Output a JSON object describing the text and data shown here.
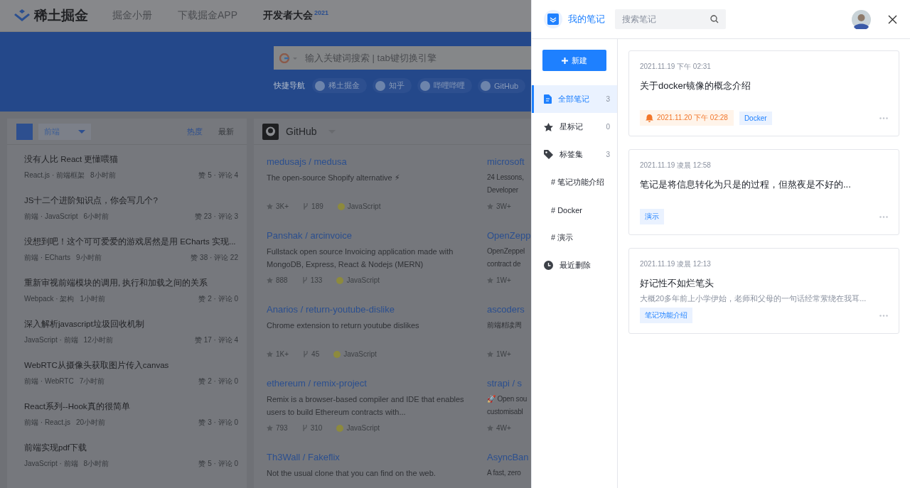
{
  "site_header": {
    "logo": "稀土掘金",
    "nav": [
      "掘金小册",
      "下载掘金APP",
      "开发者大会"
    ],
    "nav_badge": "2021"
  },
  "search": {
    "placeholder": "输入关键词搜索 | tab键切换引擎"
  },
  "quick_nav": {
    "label": "快捷导航",
    "links": [
      "稀土掘金",
      "知乎",
      "哔哩哔哩",
      "GitHub"
    ]
  },
  "article_feed": {
    "category": "前端",
    "sorts": [
      {
        "label": "热度",
        "selected": true
      },
      {
        "label": "最新",
        "selected": false
      }
    ],
    "articles": [
      {
        "title": "没有人比 React 更懂喂猫",
        "meta": "React.js · 前端框架",
        "time": "8小时前",
        "stats": "赞 5 · 评论 4"
      },
      {
        "title": "JS十二个进阶知识点，你会写几个?",
        "meta": "前端 · JavaScript",
        "time": "6小时前",
        "stats": "赞 23 · 评论 3"
      },
      {
        "title": "没想到吧！这个可可爱爱的游戏居然是用 ECharts 实现...",
        "meta": "前端 · ECharts",
        "time": "9小时前",
        "stats": "赞 38 · 评论 22"
      },
      {
        "title": "重新审视前端模块的调用, 执行和加载之间的关系",
        "meta": "Webpack · 架构",
        "time": "1小时前",
        "stats": "赞 2 · 评论 0"
      },
      {
        "title": "深入解析javascript垃圾回收机制",
        "meta": "JavaScript · 前端",
        "time": "12小时前",
        "stats": "赞 17 · 评论 4"
      },
      {
        "title": "WebRTC从摄像头获取图片传入canvas",
        "meta": "前端 · WebRTC",
        "time": "7小时前",
        "stats": "赞 2 · 评论 0"
      },
      {
        "title": "React系列--Hook真的很简单",
        "meta": "前端 · React.js",
        "time": "20小时前",
        "stats": "赞 3 · 评论 0"
      },
      {
        "title": "前端实现pdf下载",
        "meta": "JavaScript · 前端",
        "time": "8小时前",
        "stats": "赞 5 · 评论 0"
      }
    ]
  },
  "github": {
    "title": "GitHub",
    "repos": [
      {
        "name": "medusajs / medusa",
        "description": "The open-source Shopify alternative ⚡",
        "stars": "3K+",
        "forks": "189",
        "language": "JavaScript"
      },
      {
        "name": "Panshak / arcinvoice",
        "description": "Fullstack open source Invoicing application made with MongoDB, Express, React & Nodejs (MERN)",
        "stars": "888",
        "forks": "133",
        "language": "JavaScript"
      },
      {
        "name": "Anarios / return-youtube-dislike",
        "description": "Chrome extension to return youtube dislikes",
        "stars": "1K+",
        "forks": "45",
        "language": "JavaScript"
      },
      {
        "name": "ethereum / remix-project",
        "description": "Remix is a browser-based compiler and IDE that enables users to build Ethereum contracts with...",
        "stars": "793",
        "forks": "310",
        "language": "JavaScript"
      },
      {
        "name": "Th3Wall / Fakeflix",
        "description": "Not the usual clone that you can find on the web."
      }
    ],
    "repos_cut": [
      {
        "name": "microsoft",
        "description_lines": [
          "24 Lessons,",
          "Developer"
        ],
        "stars": "3W+"
      },
      {
        "name": "OpenZepp",
        "description_lines": [
          "OpenZeppel",
          "contract de"
        ],
        "stars": "1W+"
      },
      {
        "name": "ascoders",
        "description_lines": [
          "前端精读周"
        ],
        "stars": "1W+"
      },
      {
        "name": "strapi / s",
        "description_lines": [
          "🚀 Open sou",
          "customisabl"
        ],
        "stars": "4W+"
      },
      {
        "name": "AsyncBan",
        "description_lines": [
          "A fast, zero"
        ]
      }
    ]
  },
  "notes_panel": {
    "title": "我的笔记",
    "search_placeholder": "搜索笔记",
    "new_button": "新建",
    "nav": [
      {
        "kind": "all",
        "label": "全部笔记",
        "count": "3",
        "selected": true
      },
      {
        "kind": "starred",
        "label": "星标记",
        "count": "0",
        "selected": false
      },
      {
        "kind": "tags",
        "label": "标签集",
        "count": "3",
        "selected": false,
        "children": [
          {
            "label": "# 笔记功能介绍",
            "selected": false
          },
          {
            "label": "# Docker",
            "selected": false
          },
          {
            "label": "# 演示",
            "selected": false
          }
        ]
      },
      {
        "kind": "deleted",
        "label": "最近删除",
        "selected": false
      }
    ],
    "notes": [
      {
        "date": "2021.11.19 下午 02:31",
        "title": "关于docker镜像的概念介绍",
        "reminder": "2021.11.20 下午 02:28",
        "tags": [
          "Docker"
        ]
      },
      {
        "date": "2021.11.19 凌晨 12:58",
        "title": "笔记是将信息转化为只是的过程，但熬夜是不好的...",
        "tags": [
          "演示"
        ]
      },
      {
        "date": "2021.11.19 凌晨 12:13",
        "title": "好记性不如烂笔头",
        "excerpt": "大概20多年前上小学伊始，老师和父母的一句话经常萦绕在我耳...",
        "tags": [
          "笔记功能介绍"
        ]
      }
    ]
  }
}
